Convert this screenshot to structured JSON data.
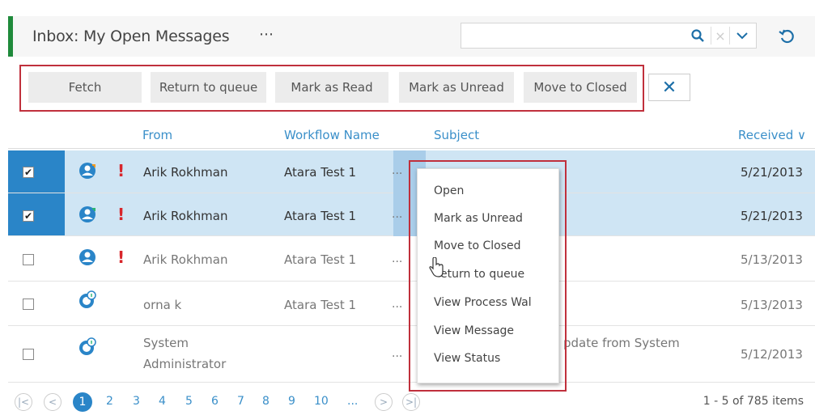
{
  "header": {
    "title": "Inbox: My Open Messages",
    "more": "⋯",
    "search_value": "",
    "clear_glyph": "×"
  },
  "toolbar": {
    "fetch": "Fetch",
    "return_to_queue": "Return to queue",
    "mark_as_read": "Mark as Read",
    "mark_as_unread": "Mark as Unread",
    "move_to_closed": "Move to Closed",
    "close_glyph": "✕"
  },
  "columns": {
    "from": "From",
    "workflow": "Workflow Name",
    "subject": "Subject",
    "received": "Received ∨"
  },
  "rows": [
    {
      "checked": "✔",
      "icon": "workflow-person-icon",
      "priority": "!",
      "from": "Arik Rokhman",
      "from2": "",
      "workflow": "Atara Test 1",
      "dots": "...",
      "subject": "",
      "received": "5/21/2013"
    },
    {
      "checked": "✔",
      "icon": "workflow-person-icon",
      "priority": "!",
      "from": "Arik Rokhman",
      "from2": "",
      "workflow": "Atara Test 1",
      "dots": "...",
      "subject": "",
      "received": "5/21/2013"
    },
    {
      "checked": "",
      "icon": "workflow-person-icon",
      "priority": "!",
      "from": "Arik Rokhman",
      "from2": "",
      "workflow": "Atara Test 1",
      "dots": "...",
      "subject": "",
      "received": "5/13/2013"
    },
    {
      "checked": "",
      "icon": "info-message-icon",
      "priority": "",
      "from": "orna k",
      "from2": "",
      "workflow": "Atara Test 1",
      "dots": "...",
      "subject": "",
      "received": "5/13/2013"
    },
    {
      "checked": "",
      "icon": "info-message-icon",
      "priority": "",
      "from": "System",
      "from2": "Administrator",
      "workflow": "",
      "dots": "...",
      "subject": "pdate from System",
      "received": "5/12/2013"
    }
  ],
  "context_menu": {
    "items": [
      "Open",
      "Mark as Unread",
      "Move to Closed",
      "Return to queue",
      "View Process Wal",
      "View Message",
      "View Status"
    ],
    "partially_hidden_label": "eturn to queue"
  },
  "pager": {
    "first": "|<",
    "prev": "<",
    "current": "1",
    "pages": [
      "2",
      "3",
      "4",
      "5",
      "6",
      "7",
      "8",
      "9",
      "10",
      "..."
    ],
    "next": ">",
    "last": ">|",
    "info": "1 - 5 of 785 items"
  },
  "colors": {
    "accent_green": "#1f8a3b",
    "selection_blue": "#2a85c8",
    "link_blue": "#3a8fc9",
    "highlight_red": "#c0303c",
    "priority_red": "#d8262b"
  }
}
